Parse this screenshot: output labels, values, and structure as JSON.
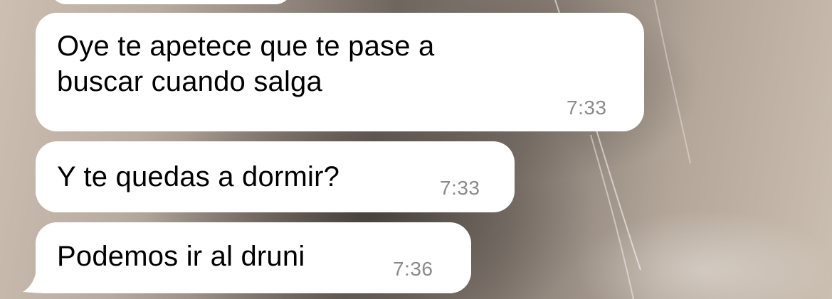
{
  "messages": [
    {
      "text_line1": "Oye te apetece que te pase a",
      "text_line2": "buscar cuando salga",
      "time": "7:33"
    },
    {
      "text": "Y te quedas a dormir?",
      "time": "7:33"
    },
    {
      "text": "Podemos ir al druni",
      "time": "7:36"
    }
  ]
}
